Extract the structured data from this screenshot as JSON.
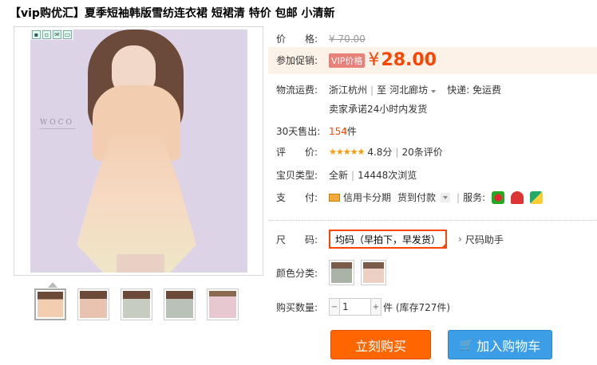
{
  "title": "【vip购优汇】夏季短袖韩版雪纺连衣裙 短裙清 特价 包邮 小清新",
  "image": {
    "watermark_line1": "WOCO"
  },
  "price": {
    "label": "价　　格:",
    "original": "¥ 70.00"
  },
  "promo": {
    "label": "参加促销:",
    "tag": "VIP价格",
    "yen": "¥",
    "value": "28.00"
  },
  "shipping": {
    "label": "物流运费:",
    "from": "浙江杭州",
    "to_prefix": "至",
    "to": "河北廊坊",
    "fee": "快递: 免运费",
    "promise": "卖家承诺24小时内发货"
  },
  "sales": {
    "label": "30天售出:",
    "count": "154",
    "unit": "件"
  },
  "rating": {
    "label": "评　　价:",
    "stars": "★★★★★",
    "score": "4.8分",
    "reviews": "20条评价"
  },
  "item_type": {
    "label": "宝贝类型:",
    "condition": "全新",
    "views": "14448次浏览"
  },
  "payment": {
    "label": "支　　付:",
    "credit": "信用卡分期",
    "cod": "货到付款",
    "service_label": "服务:"
  },
  "size": {
    "label": "尺　　码:",
    "selected": "均码（早拍下，早发货）",
    "helper": "尺码助手",
    "chevron": "›"
  },
  "color": {
    "label": "颜色分类:"
  },
  "quantity": {
    "label": "购买数量:",
    "value": "1",
    "minus": "−",
    "plus": "+",
    "stock": "件 (库存727件)"
  },
  "buttons": {
    "buy_now": "立刻购买",
    "add_cart": "加入购物车",
    "cart_icon": "🛒"
  },
  "colors": {
    "accent": "#ff4400",
    "buy": "#ff6600",
    "cart": "#3c9ee6",
    "promo_bg": "#fdf2e8"
  }
}
